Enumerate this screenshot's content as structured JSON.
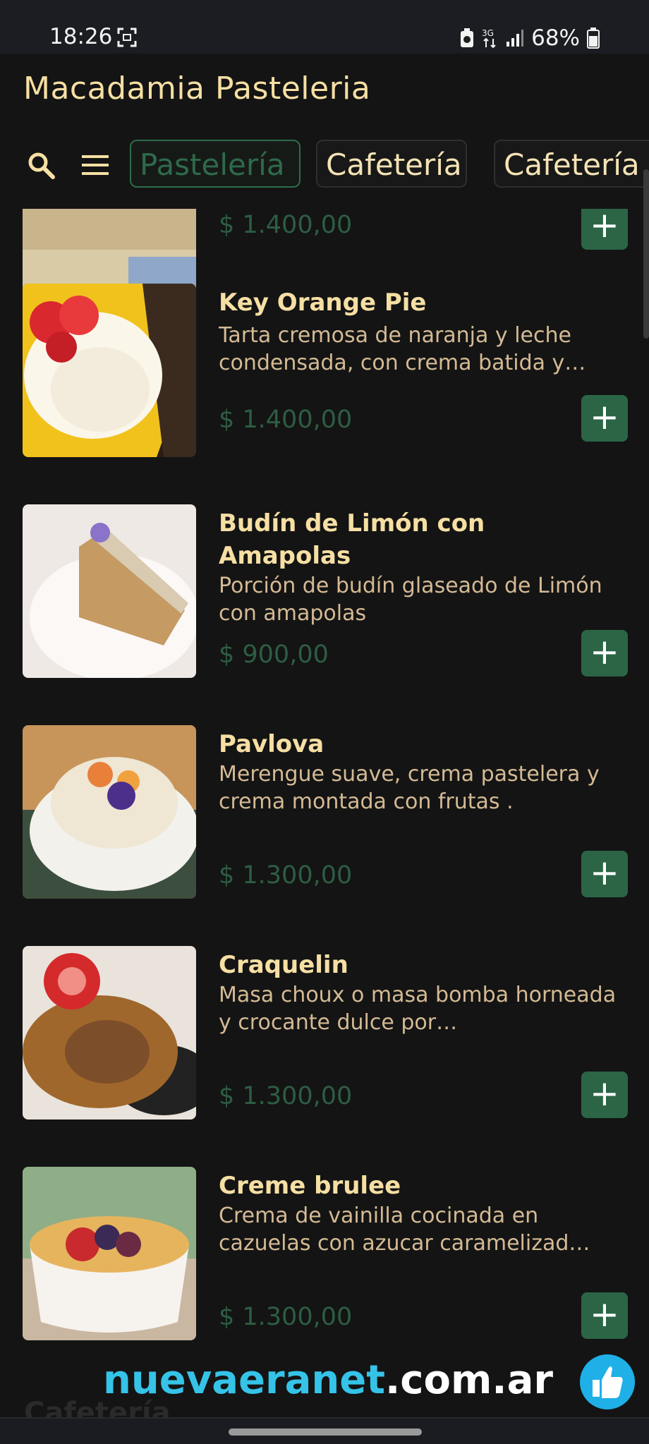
{
  "status_bar": {
    "time": "18:26",
    "network": "3G",
    "battery": "68%"
  },
  "app": {
    "title": "Macadamia Pasteleria"
  },
  "tabs": [
    {
      "label": "Pastelería",
      "active": true
    },
    {
      "label": "Cafetería",
      "active": false
    },
    {
      "label": "Cafetería",
      "active": false
    }
  ],
  "products": [
    {
      "name": "",
      "description": "",
      "price": "$ 1.400,00",
      "add_label": "+"
    },
    {
      "name": "Key Orange Pie",
      "description": "Tarta cremosa de naranja y leche condensada, con crema batida y…",
      "price": "$ 1.400,00",
      "add_label": "+"
    },
    {
      "name": "Budín de Limón con Amapolas",
      "description": "Porción de budín glaseado de Limón con amapolas",
      "price": "$ 900,00",
      "add_label": "+"
    },
    {
      "name": "Pavlova",
      "description": "Merengue suave, crema pastelera y crema montada con frutas .",
      "price": "$ 1.300,00",
      "add_label": "+"
    },
    {
      "name": "Craquelin",
      "description": "Masa choux o masa bomba horneada y crocante dulce por…",
      "price": "$ 1.300,00",
      "add_label": "+"
    },
    {
      "name": "Creme brulee",
      "description": "Crema de vainilla cocinada en cazuelas con azucar caramelizad…",
      "price": "$ 1.300,00",
      "add_label": "+"
    }
  ],
  "next_section": "Cafetería",
  "watermark": {
    "part1": "nuevaeranet",
    "part2": ".com.ar"
  },
  "colors": {
    "accent_green": "#2b6546",
    "title_gold": "#f6dfa3",
    "description_tan": "#d4ba94",
    "background": "#141414"
  }
}
